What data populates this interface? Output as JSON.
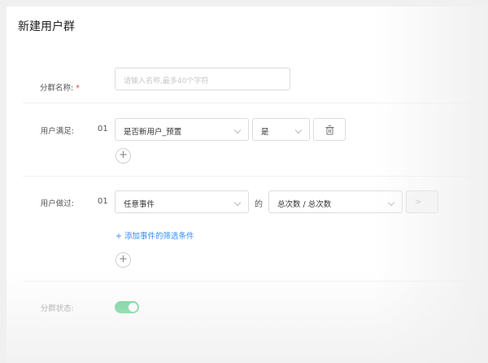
{
  "page": {
    "title": "新建用户群"
  },
  "name_row": {
    "label": "分群名称:",
    "required_mark": "*",
    "placeholder": "请输入名称,最多40个字符"
  },
  "condition_row": {
    "label": "用户满足:",
    "index": "01",
    "property": "是否新用户_预置",
    "operator": "是",
    "delete_icon": "trash-icon",
    "add_icon": "plus-icon",
    "add_symbol": "+"
  },
  "event_row": {
    "label": "用户做过:",
    "index": "01",
    "event": "任意事件",
    "connector": "的",
    "metric": "总次数 / 总次数",
    "more_symbol": ">",
    "add_filter_label": "+ 添加事件的筛选条件",
    "add_symbol": "+"
  },
  "status_row": {
    "label": "分群状态:",
    "enabled": true,
    "toggle_color": "#5fcf8a"
  },
  "colors": {
    "accent": "#2f8cff",
    "required": "#e0443b"
  }
}
